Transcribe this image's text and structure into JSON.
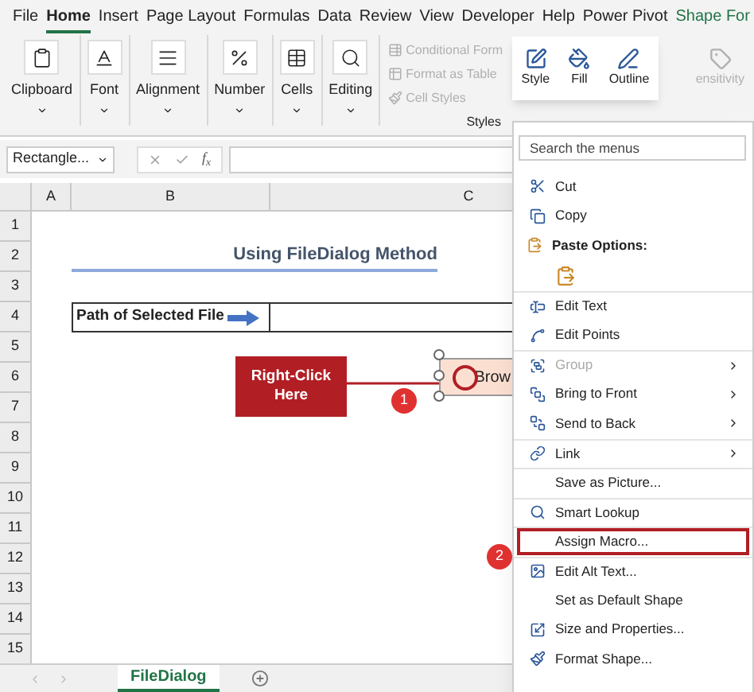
{
  "ribbon_tabs": [
    {
      "label": "File",
      "selected": false
    },
    {
      "label": "Home",
      "selected": true
    },
    {
      "label": "Insert",
      "selected": false
    },
    {
      "label": "Page Layout",
      "selected": false
    },
    {
      "label": "Formulas",
      "selected": false
    },
    {
      "label": "Data",
      "selected": false
    },
    {
      "label": "Review",
      "selected": false
    },
    {
      "label": "View",
      "selected": false
    },
    {
      "label": "Developer",
      "selected": false
    },
    {
      "label": "Help",
      "selected": false
    },
    {
      "label": "Power Pivot",
      "selected": false
    },
    {
      "label": "Shape For",
      "selected": false,
      "kind": "contextual"
    }
  ],
  "ribbon_groups": [
    {
      "label": "Clipboard"
    },
    {
      "label": "Font"
    },
    {
      "label": "Alignment"
    },
    {
      "label": "Number"
    },
    {
      "label": "Cells"
    },
    {
      "label": "Editing"
    }
  ],
  "styles_group": {
    "label": "Styles",
    "items": [
      {
        "label": "Conditional Form",
        "disabled": true
      },
      {
        "label": "Format as Table",
        "disabled": true
      },
      {
        "label": "Cell Styles",
        "disabled": true
      }
    ]
  },
  "sensitivity": {
    "label": "ensitivity",
    "disabled": true
  },
  "mini_toolbar": [
    {
      "label": "Style"
    },
    {
      "label": "Fill"
    },
    {
      "label": "Outline"
    }
  ],
  "formula_bar": {
    "name_box": "Rectangle...",
    "function_label": "f$_{x}$"
  },
  "sheet": {
    "columns": [
      "A",
      "B",
      "C"
    ],
    "rows": [
      "1",
      "2",
      "3",
      "4",
      "5",
      "6",
      "7",
      "8",
      "9",
      "10",
      "11",
      "12",
      "13",
      "14",
      "15"
    ],
    "title": "Using FileDialog Method",
    "path_label": "Path of Selected File"
  },
  "callout": {
    "text": "Right-Click Here"
  },
  "shape_button": {
    "text": "Brow"
  },
  "badges": [
    "1",
    "2"
  ],
  "context_menu": {
    "search_placeholder": "Search the menus",
    "items": [
      {
        "label": "Cut",
        "kind": "item",
        "disabled": false,
        "submenu": false,
        "highlighted": false,
        "separated": false
      },
      {
        "label": "Copy",
        "kind": "item",
        "disabled": false,
        "submenu": false,
        "highlighted": false,
        "separated": false
      },
      {
        "label": "Paste Options:",
        "kind": "header"
      },
      {
        "kind": "paste"
      },
      {
        "label": "Edit Text",
        "kind": "item",
        "disabled": false,
        "submenu": false,
        "highlighted": false,
        "separated": true
      },
      {
        "label": "Edit Points",
        "kind": "item",
        "disabled": false,
        "submenu": false,
        "highlighted": false,
        "separated": false
      },
      {
        "label": "Group",
        "kind": "item",
        "disabled": true,
        "submenu": true,
        "highlighted": false,
        "separated": true
      },
      {
        "label": "Bring to Front",
        "kind": "item",
        "disabled": false,
        "submenu": true,
        "highlighted": false,
        "separated": false
      },
      {
        "label": "Send to Back",
        "kind": "item",
        "disabled": false,
        "submenu": true,
        "highlighted": false,
        "separated": false
      },
      {
        "label": "Link",
        "kind": "item",
        "disabled": false,
        "submenu": true,
        "highlighted": false,
        "separated": true
      },
      {
        "label": "Save as Picture...",
        "kind": "item",
        "disabled": false,
        "submenu": false,
        "highlighted": false,
        "separated": true
      },
      {
        "label": "Smart Lookup",
        "kind": "item",
        "disabled": false,
        "submenu": false,
        "highlighted": false,
        "separated": true
      },
      {
        "label": "Assign Macro...",
        "kind": "item",
        "disabled": false,
        "submenu": false,
        "highlighted": true,
        "separated": true
      },
      {
        "label": "Edit Alt Text...",
        "kind": "item",
        "disabled": false,
        "submenu": false,
        "highlighted": false,
        "separated": true
      },
      {
        "label": "Set as Default Shape",
        "kind": "item",
        "disabled": false,
        "submenu": false,
        "highlighted": false,
        "separated": false
      },
      {
        "label": "Size and Properties...",
        "kind": "item",
        "disabled": false,
        "submenu": false,
        "highlighted": false,
        "separated": false
      },
      {
        "label": "Format Shape...",
        "kind": "item",
        "disabled": false,
        "submenu": false,
        "highlighted": false,
        "separated": false
      }
    ]
  },
  "sheet_tabs": [
    {
      "label": "FileDialog",
      "selected": true
    }
  ]
}
